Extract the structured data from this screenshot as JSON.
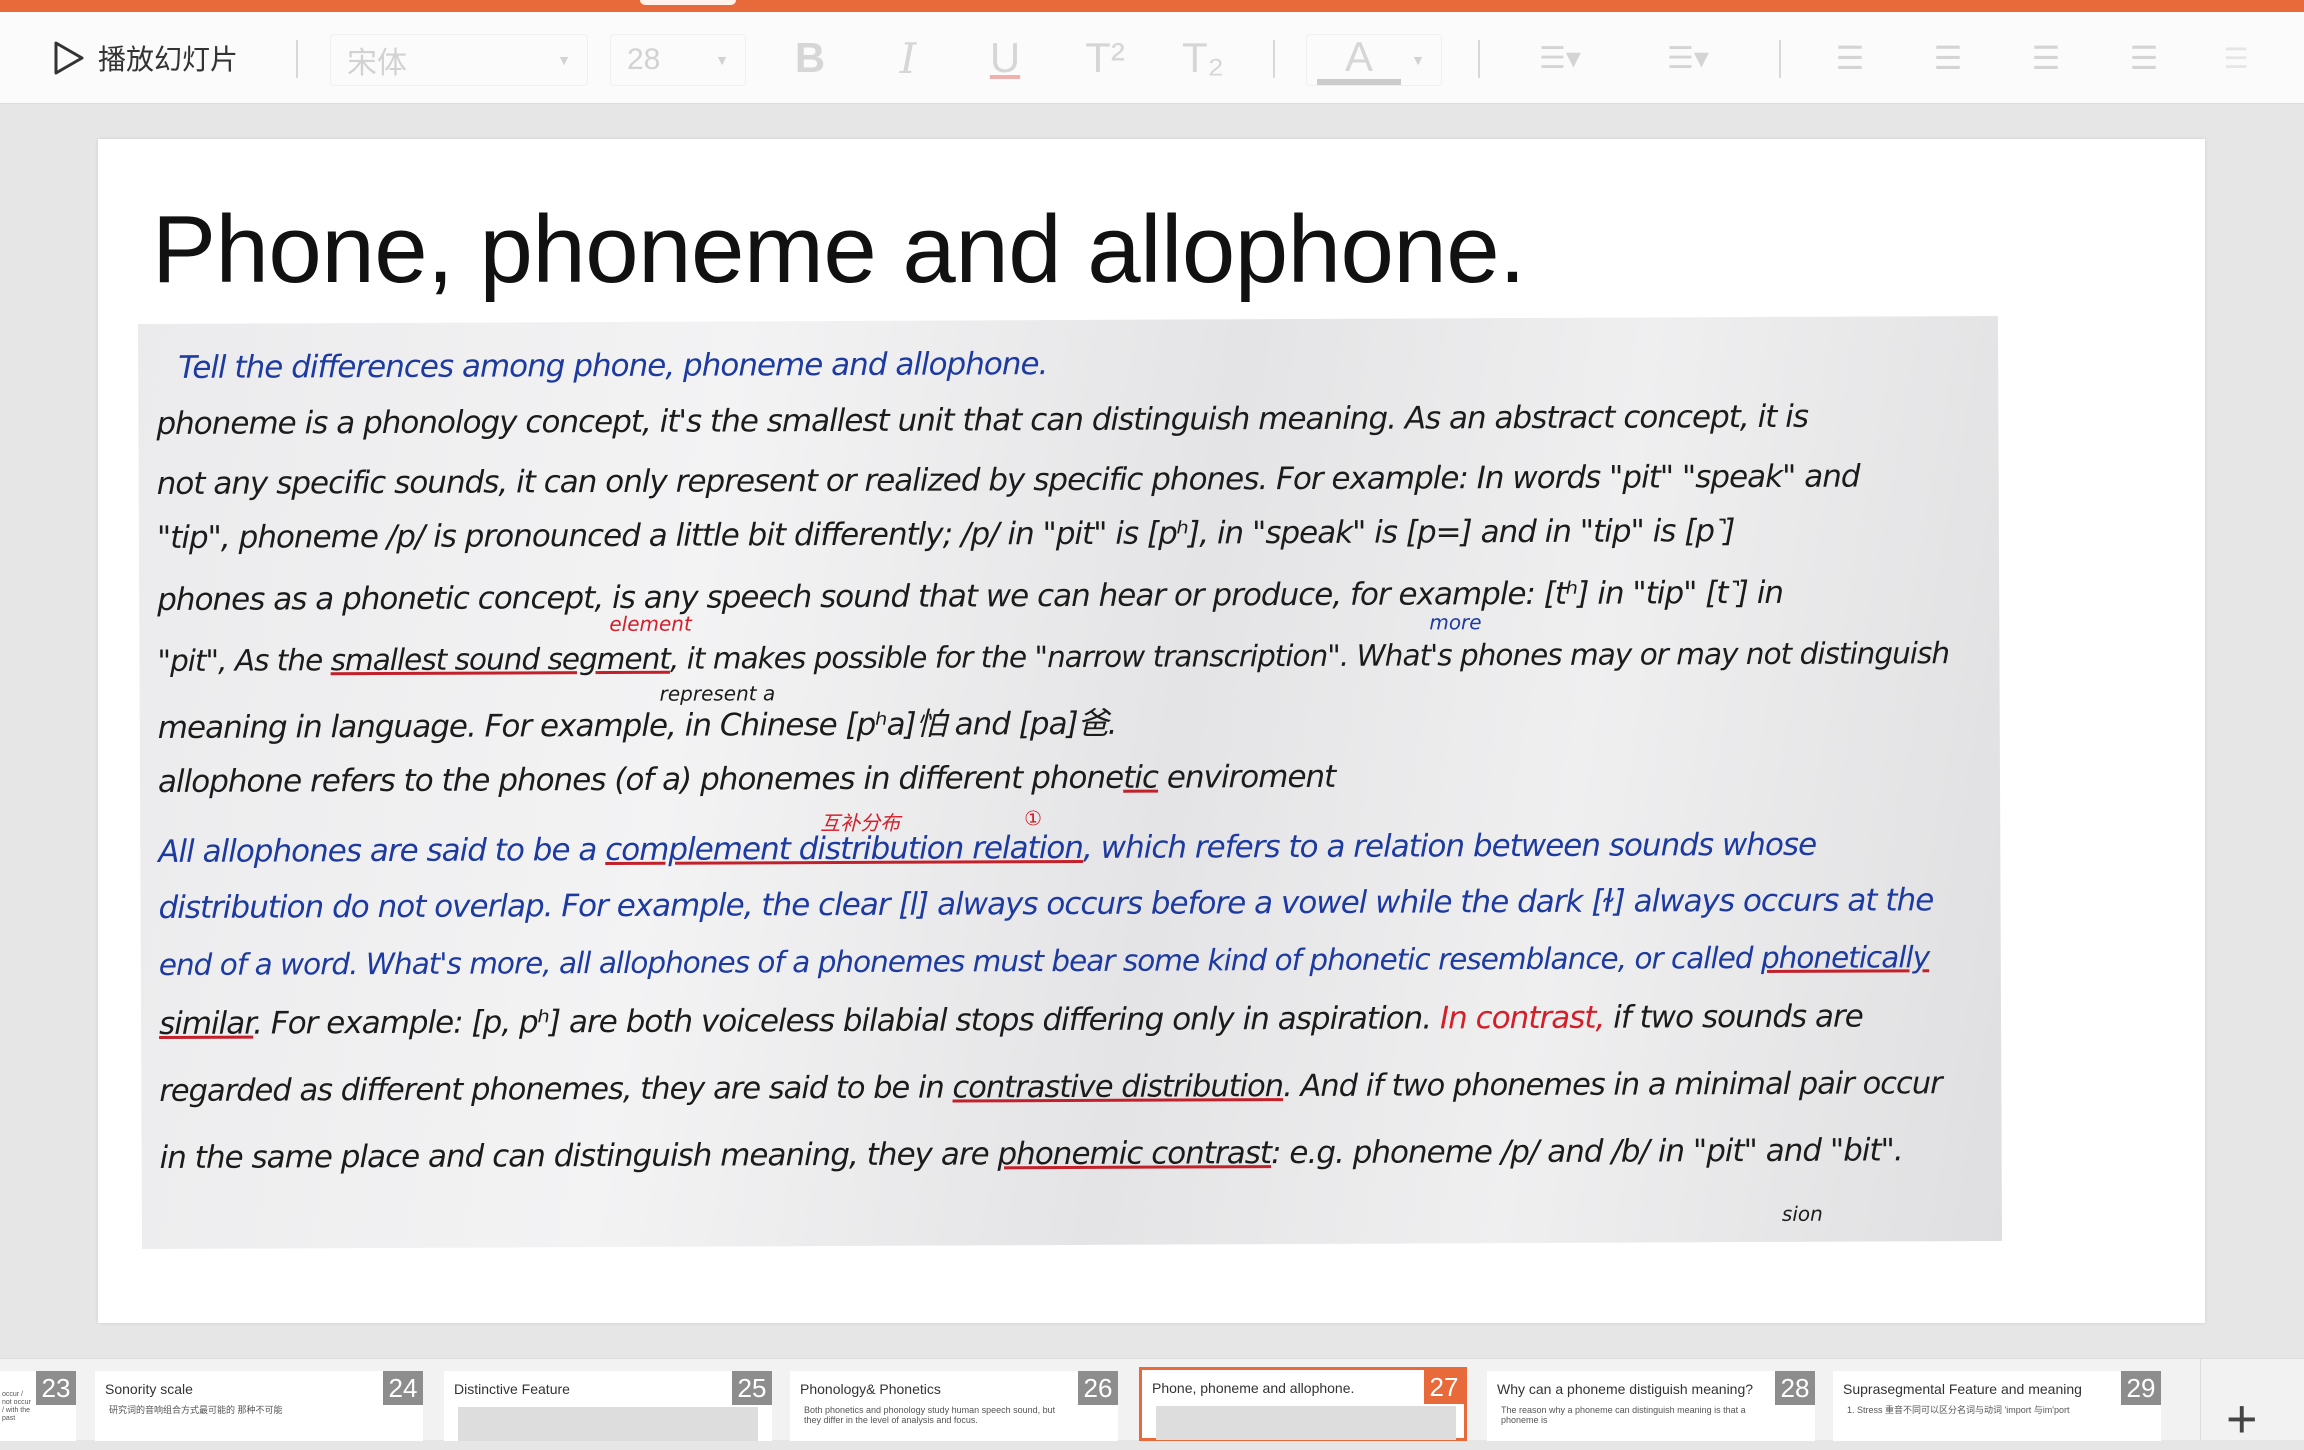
{
  "toolbar": {
    "play_label": "播放幻灯片",
    "font_name": "宋体",
    "font_size": "28",
    "bold": "B",
    "italic": "I",
    "underline": "U",
    "superscript": "T²",
    "subscript": "T₂",
    "font_color": "A"
  },
  "slide": {
    "title": "Phone, phoneme and allophone.",
    "handwriting": [
      [
        [
          "b",
          "Tell the differences among phone, phoneme and allophone."
        ]
      ],
      [
        [
          "k",
          "     phoneme is a phonology concept, it's the smallest unit that can distinguish meaning. As an abstract concept, it is"
        ]
      ],
      [
        [
          "k",
          "not any specific sounds, it can only represent or realized by specific phones.  For example: In words \"pit\" \"speak\" and"
        ]
      ],
      [
        [
          "k",
          "\"tip\", phoneme /p/ is pronounced a little bit differently; /p/ in \"pit\" is [pʰ], in \"speak\" is [p=] and in \"tip\" is [p˺]"
        ]
      ],
      [
        [
          "k",
          "     phones as a phonetic concept, is any speech sound that we can hear or produce,  for example: [tʰ] in \"tip\" [t˺] in"
        ]
      ],
      [
        [
          "k",
          "\"pit\", As the "
        ],
        [
          "k ul",
          "smallest sound segment"
        ],
        [
          "k",
          ",  it makes possible for the \"narrow transcription\". What's phones may or may not distinguish"
        ]
      ],
      [
        [
          "k",
          "meaning in language.  For example,  in Chinese [pʰa]怕 and [pa]爸."
        ]
      ],
      [
        [
          "k",
          "     allophone refers to the phones (of a) phonemes in different phone"
        ],
        [
          "k ul",
          "tic"
        ],
        [
          "k",
          " enviroment"
        ]
      ],
      [
        [
          "b",
          "     All allophones are said to be a "
        ],
        [
          "b ul",
          "complement distribution relation"
        ],
        [
          "b",
          ", which refers to a relation between sounds whose"
        ]
      ],
      [
        [
          "b",
          "distribution do not overlap.  For example, the clear [l] always occurs before a vowel while the dark [ɫ] always occurs at the"
        ]
      ],
      [
        [
          "b",
          "end of a word. What's more, all allophones of a phonemes must bear some kind of phonetic resemblance, or called "
        ],
        [
          "b ul",
          "phonetically"
        ]
      ],
      [
        [
          "k ul",
          "similar"
        ],
        [
          "k",
          ".  For example: [p, pʰ] are both voiceless bilabial stops differing only in aspiration.  "
        ],
        [
          "r",
          "In contrast,"
        ],
        [
          "k",
          "  if two sounds are"
        ]
      ],
      [
        [
          "k",
          "regarded as different phonemes, they are said to be in "
        ],
        [
          "k ul",
          "contrastive distribution"
        ],
        [
          "k",
          ".  And if two phonemes in a minimal pair occur"
        ]
      ],
      [
        [
          "k",
          "in the same place and can distinguish meaning, they are "
        ],
        [
          "k ul",
          "phonemic contrast"
        ],
        [
          "k",
          ":  e.g.  phoneme /p/ and /b/ in \"pit\" and \"bit\"."
        ]
      ]
    ],
    "annotations": {
      "element": "element",
      "more": "more",
      "represent_a": "represent a",
      "chinese_note": "互补分布",
      "circle_1": "①",
      "bottom_fragment": "sion"
    }
  },
  "thumbnails": [
    {
      "num": "23",
      "title": "",
      "sub": "occur / not occur / with the past"
    },
    {
      "num": "24",
      "title": "Sonority scale",
      "sub": "研究词的音响组合方式最可能的 那种不可能"
    },
    {
      "num": "25",
      "title": "Distinctive Feature",
      "sub": ""
    },
    {
      "num": "26",
      "title": "Phonology& Phonetics",
      "sub": "Both phonetics and phonology study human speech sound, but they differ in the level of analysis and focus."
    },
    {
      "num": "27",
      "title": "Phone, phoneme and allophone.",
      "sub": "",
      "active": true
    },
    {
      "num": "28",
      "title": "Why can a phoneme distiguish meaning?",
      "sub": "The reason why a phoneme can distinguish meaning is that a phoneme is"
    },
    {
      "num": "29",
      "title": "Suprasegmental Feature and meaning",
      "sub": "1. Stress 重音不同可以区分名词与动词 'import 与im'port"
    }
  ],
  "colors": {
    "accent": "#e86a3a",
    "ink_black": "#1b1b1b",
    "ink_blue": "#1c3aa0",
    "ink_red": "#d21f2a"
  }
}
